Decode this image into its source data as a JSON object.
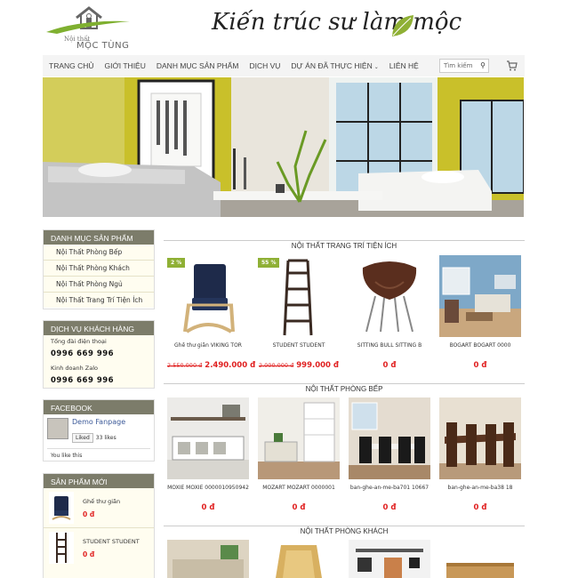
{
  "logo": {
    "sub": "Nội thất",
    "name": "MỘC TÙNG"
  },
  "slogan": "Kiến trúc sư làm mộc",
  "nav": [
    "TRANG CHỦ",
    "GIỚI THIỆU",
    "DANH MỤC SẢN PHẨM",
    "DỊCH VỤ",
    "DỰ ÁN ĐÃ THỰC HIỆN",
    "LIÊN HỆ"
  ],
  "search": {
    "placeholder": "Tìm kiếm"
  },
  "categories": {
    "title": "DANH MỤC SẢN PHẨM",
    "items": [
      "Nội Thất Phòng Bếp",
      "Nội Thất Phòng Khách",
      "Nội Thất Phòng Ngủ",
      "Nội Thất Trang Trí Tiện Ích"
    ]
  },
  "service": {
    "title": "DỊCH VỤ KHÁCH HÀNG",
    "phone_label": "Tổng đài điện thoại",
    "phone": "0996 669 996",
    "zalo_label": "Kinh doanh Zalo",
    "zalo": "0996 669 996"
  },
  "facebook": {
    "title": "FACEBOOK",
    "page_name": "Demo Fanpage",
    "like_label": "Liked",
    "like_count": "33 likes",
    "you_like": "You like this"
  },
  "new_products": {
    "title": "SẢN PHẨM MỚI",
    "items": [
      {
        "name": "Ghế thư giãn",
        "price": "0 đ"
      },
      {
        "name": "STUDENT STUDENT",
        "price": "0 đ"
      }
    ]
  },
  "sections": [
    {
      "title": "NỘI THẤT TRANG TRÍ TIỆN ÍCH",
      "products": [
        {
          "badge": "2 %",
          "name": "Ghế thư giãn VIKING TOR",
          "old_price": "2.550.000 đ",
          "price": "2.490.000 đ"
        },
        {
          "badge": "55 %",
          "name": "STUDENT STUDENT",
          "old_price": "2.000.000 đ",
          "price": "999.000 đ"
        },
        {
          "badge": "",
          "name": "SITTING BULL SITTING B",
          "old_price": "",
          "price": "0 đ"
        },
        {
          "badge": "",
          "name": "BOGART BOGART 0000",
          "old_price": "",
          "price": "0 đ"
        }
      ]
    },
    {
      "title": "NỘI THẤT PHÒNG BẾP",
      "products": [
        {
          "badge": "",
          "name": "MOXIE MOXIE 0000010950942",
          "old_price": "",
          "price": "0 đ"
        },
        {
          "badge": "",
          "name": "MOZART MOZART 0000001",
          "old_price": "",
          "price": "0 đ"
        },
        {
          "badge": "",
          "name": "ban-ghe-an-me-ba701 10667",
          "old_price": "",
          "price": "0 đ"
        },
        {
          "badge": "",
          "name": "ban-ghe-an-me-ba38 18",
          "old_price": "",
          "price": "0 đ"
        }
      ]
    },
    {
      "title": "NỘI THẤT PHÒNG KHÁCH",
      "products": []
    }
  ],
  "colors": {
    "accent": "#8fb035",
    "price": "#e02020",
    "sidebar_header": "#7c7c6a",
    "sidebar_bg": "#fffdf0",
    "wall": "#c9c02a"
  },
  "icons": {
    "search": "search-icon",
    "cart": "cart-icon",
    "logo": "house-icon",
    "leaf": "leaf-icon"
  }
}
